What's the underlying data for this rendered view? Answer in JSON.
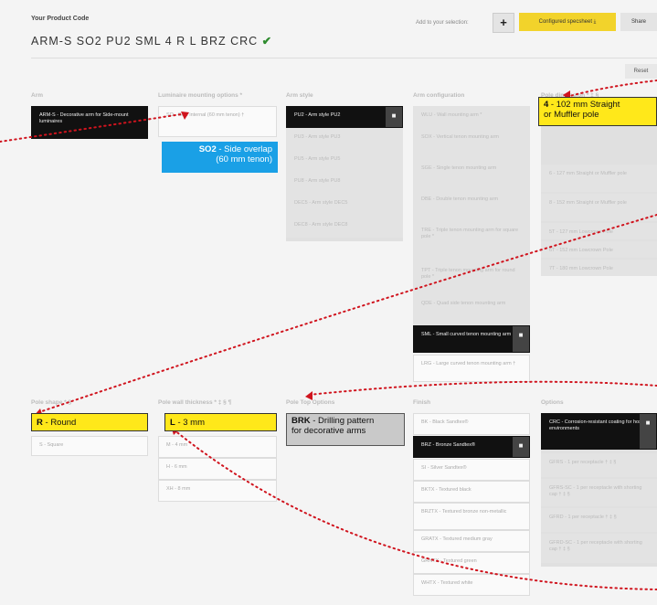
{
  "header": {
    "label": "Your Product Code",
    "code": "ARM-S SO2 PU2 SML 4 R L BRZ CRC",
    "check": "✔",
    "add_label": "Add to your selection:",
    "plus_label": "+",
    "spec_label": "Configured specsheet ⤓",
    "share_label": "Share",
    "reset_label": "Reset"
  },
  "columns_top": [
    {
      "title": "Arm"
    },
    {
      "title": "Luminaire mounting options *"
    },
    {
      "title": "Arm style"
    },
    {
      "title": "Arm configuration"
    },
    {
      "title": "Pole dimension * ‡ §"
    }
  ],
  "arm": {
    "selected": "ARM-S - Decorative arm for Side-mount luminaires"
  },
  "mounting": {
    "option": "SO - Side internal (60 mm tenon) †"
  },
  "arm_style": {
    "selected": "PU2 - Arm style PU2",
    "options": [
      "PU3 - Arm style PU3",
      "PU5 - Arm style PU5",
      "PU8 - Arm style PU8",
      "DEC5 - Arm style DEC5",
      "DEC8 - Arm style DEC8"
    ]
  },
  "arm_config": {
    "options": [
      "WLU - Wall mounting arm *",
      "SOX - Vertical tenon mounting arm",
      "SGE - Single tenon mounting arm",
      "DBE - Double tenon mounting arm",
      "TRE - Triple tenon mounting arm for square pole *",
      "TPT - Triple tenon mounting arm for round pole *",
      "QDE - Quad side tenon mounting arm"
    ],
    "selected": "SML - Small curved tenon mounting arm †",
    "after": "LRG - Large curved tenon mounting arm †"
  },
  "pole_dim": {
    "options": [
      "6 - 127 mm Straight or Muffler pole",
      "8 - 152 mm Straight or Muffler pole",
      "5T - 127 mm Lowcrown Pole",
      "6T - 152 mm Lowcrown Pole",
      "7T - 180 mm Lowcrown Pole"
    ]
  },
  "columns_bottom": [
    {
      "title": "Pole shape * §"
    },
    {
      "title": "Pole wall thickness * ‡ § ¶"
    },
    {
      "title": "Pole Top Options"
    },
    {
      "title": "Finish"
    },
    {
      "title": "Options"
    }
  ],
  "pole_shape": {
    "options": [
      "S - Square"
    ]
  },
  "wall": {
    "options": [
      "M - 4 mm",
      "H - 6 mm",
      "XH - 8 mm"
    ]
  },
  "finish": {
    "before": "BK - Black Sandtex®",
    "selected": "BRZ - Bronze Sandtex®",
    "options": [
      "SI - Silver Sandtex®",
      "BKTX - Textured black",
      "BRZTX - Textured bronze non-metallic",
      "GRATX - Textured medium gray",
      "GRNTX - Textured green",
      "WHTX - Textured white"
    ]
  },
  "options_col": {
    "selected": "CRC - Corrosion-resistant coating for hostile environments",
    "options": [
      "GFRS - 1 per receptacle † ‡ §",
      "GFRS-SC - 1 per receptacle with shorting cap † ‡ §",
      "GFRD - 1 per receptacle † ‡ §",
      "GFRD-SC - 1 per receptacle with shorting cap † ‡ §"
    ]
  },
  "callouts": {
    "so2_code": "SO2",
    "so2_text": " - Side overlap",
    "so2_text2": "(60 mm tenon)",
    "pole_code": "4",
    "pole_text": " - 102 mm Straight",
    "pole_text2": "or Muffler pole",
    "round_code": "R",
    "round_text": " - Round",
    "wall_code": "L",
    "wall_text": " - 3 mm",
    "brk_code": "BRK",
    "brk_text": " - Drilling pattern",
    "brk_text2": "for decorative arms"
  },
  "colors": {
    "accent_yellow": "#ffe81a",
    "callout_blue": "#1aa0e6",
    "arrow_red": "#d0141e",
    "spec_yellow": "#f2d32b"
  }
}
